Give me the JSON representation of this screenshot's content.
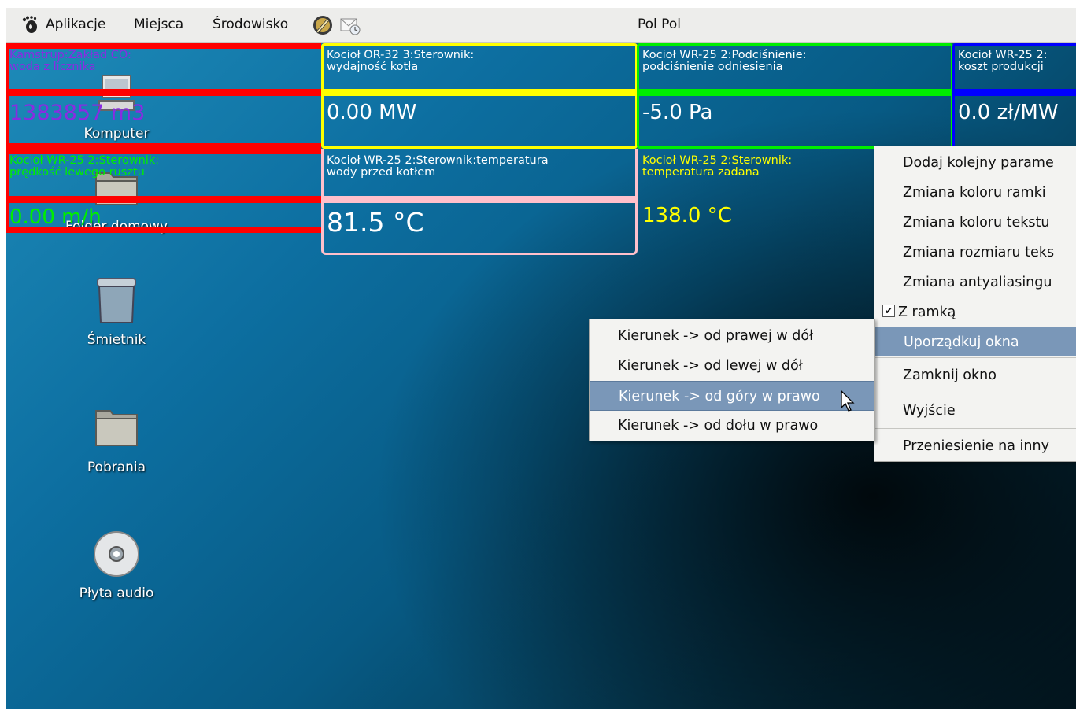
{
  "panel": {
    "menus": [
      "Aplikacje",
      "Miejsca",
      "Środowisko"
    ],
    "user": "Pol Pol"
  },
  "desktop_icons": [
    {
      "label": "Komputer",
      "icon": "computer-icon"
    },
    {
      "label": "Folder domowy",
      "icon": "folder-home-icon"
    },
    {
      "label": "Śmietnik",
      "icon": "trash-icon"
    },
    {
      "label": "Pobrania",
      "icon": "folder-icon"
    },
    {
      "label": "Płyta audio",
      "icon": "cd-icon"
    }
  ],
  "widgets": [
    {
      "title": "Kamstrup:Zakład CO:\nwoda z licznika",
      "value": "1383857 m3",
      "frame": "#ff0000",
      "text": "#8a2be2"
    },
    {
      "title": "Kocioł OR-32 3:Sterownik:\nwydajność kotła",
      "value": "0.00 MW",
      "frame": "#ffff00",
      "text": "#ffffff"
    },
    {
      "title": "Kocioł WR-25 2:Podciśnienie:\npodciśnienie odniesienia",
      "value": "-5.0 Pa",
      "frame": "#00ee00",
      "text": "#ffffff"
    },
    {
      "title": "Kocioł WR-25 2:\nkoszt produkcji",
      "value": "0.0 zł/MW",
      "frame": "#0000ff",
      "text": "#ffffff"
    },
    {
      "title": "Kocioł WR-25 2:Sterownik:\nprędkość lewego rusztu",
      "value": "0.00 m/h",
      "frame": "#ff0000",
      "text": "#00ee00"
    },
    {
      "title": "Kocioł WR-25 2:Sterownik:temperatura\nwody przed kotłem",
      "value": "81.5 °C",
      "frame": "#ffc0cb",
      "text": "#ffffff"
    },
    {
      "title": "Kocioł WR-25 2:Sterownik:\ntemperatura zadana",
      "value": "138.0 °C",
      "frame": "none",
      "text": "#ffff00"
    }
  ],
  "context_menu": {
    "items": [
      "Dodaj kolejny parame",
      "Zmiana koloru ramki",
      "Zmiana koloru tekstu",
      "Zmiana rozmiaru teks",
      "Zmiana antyaliasingu",
      "Z ramką",
      "Uporządkuj okna",
      "Zamknij okno",
      "Wyjście",
      "Przeniesienie na inny"
    ],
    "checked": "Z ramką",
    "highlighted": "Uporządkuj okna"
  },
  "submenu": {
    "items": [
      "Kierunek -> od prawej w dół",
      "Kierunek -> od lewej w dół",
      "Kierunek -> od góry w prawo",
      "Kierunek -> od dołu w prawo"
    ],
    "highlighted": "Kierunek -> od góry w prawo"
  },
  "colors": {
    "accent_highlight": "#7a97b8",
    "panel_bg": "#ededeb"
  }
}
